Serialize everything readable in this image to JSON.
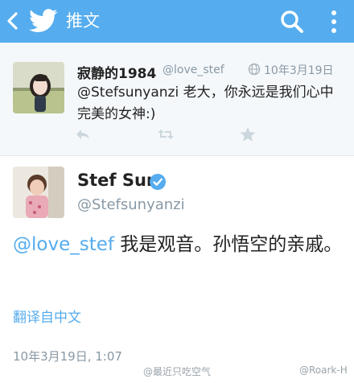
{
  "header": {
    "title": "推文",
    "brand_color": "#55acee"
  },
  "reply_tweet": {
    "display_name": "寂静的1984",
    "handle": "@love_stef",
    "date": "10年3月19日",
    "text": "@Stefsunyanzi 老大，你永远是我们心中完美的女神:)",
    "icons": [
      "reply-icon",
      "retweet-icon",
      "favorite-icon",
      "globe-icon"
    ]
  },
  "main_tweet": {
    "display_name": "Stef Sun",
    "handle": "@Stefsunyanzi",
    "mention": "@love_stef",
    "text": " 我是观音。孙悟空的亲戚。",
    "translate_label": "翻译自中文",
    "timestamp": "10年3月19日, 1:07",
    "verified": true
  },
  "watermarks": [
    "@最近只吃空气",
    "@Roark-H"
  ]
}
